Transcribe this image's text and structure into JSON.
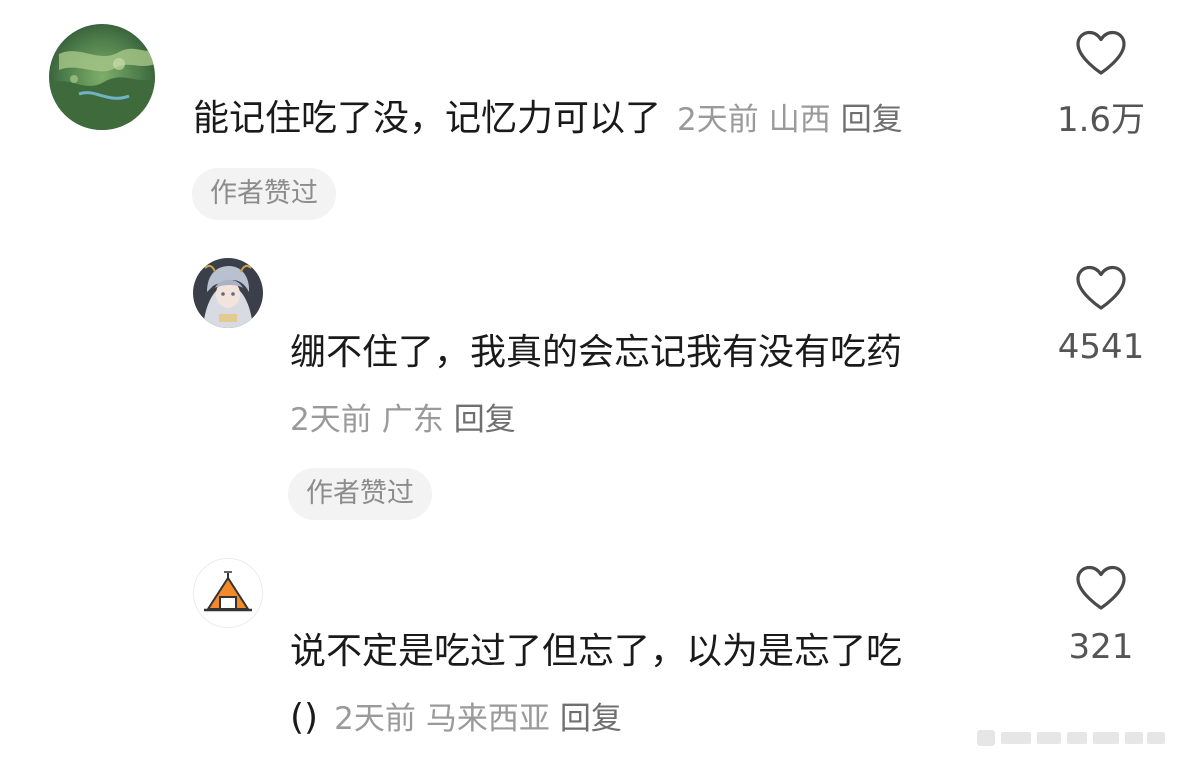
{
  "comments": [
    {
      "text": "能记住吃了没，记忆力可以了",
      "time": "2天前",
      "location": "山西",
      "reply_label": "回复",
      "badge": "作者赞过",
      "likes": "1.6万",
      "avatar_icon": "landscape-avatar"
    },
    {
      "text": "绷不住了，我真的会忘记我有没有吃药",
      "time": "2天前",
      "location": "广东",
      "reply_label": "回复",
      "badge": "作者赞过",
      "likes": "4541",
      "avatar_icon": "anime-character-avatar"
    },
    {
      "text": "说不定是吃过了但忘了，以为是忘了吃",
      "text_cont": "()",
      "time": "2天前",
      "location": "马来西亚",
      "reply_label": "回复",
      "likes": "321",
      "avatar_icon": "tent-avatar"
    }
  ],
  "colors": {
    "text": "#1a1a1a",
    "meta": "#9a9a9a",
    "badge_bg": "#f3f3f3",
    "heart": "#4a4a4a",
    "tent": "#f28a2a"
  }
}
